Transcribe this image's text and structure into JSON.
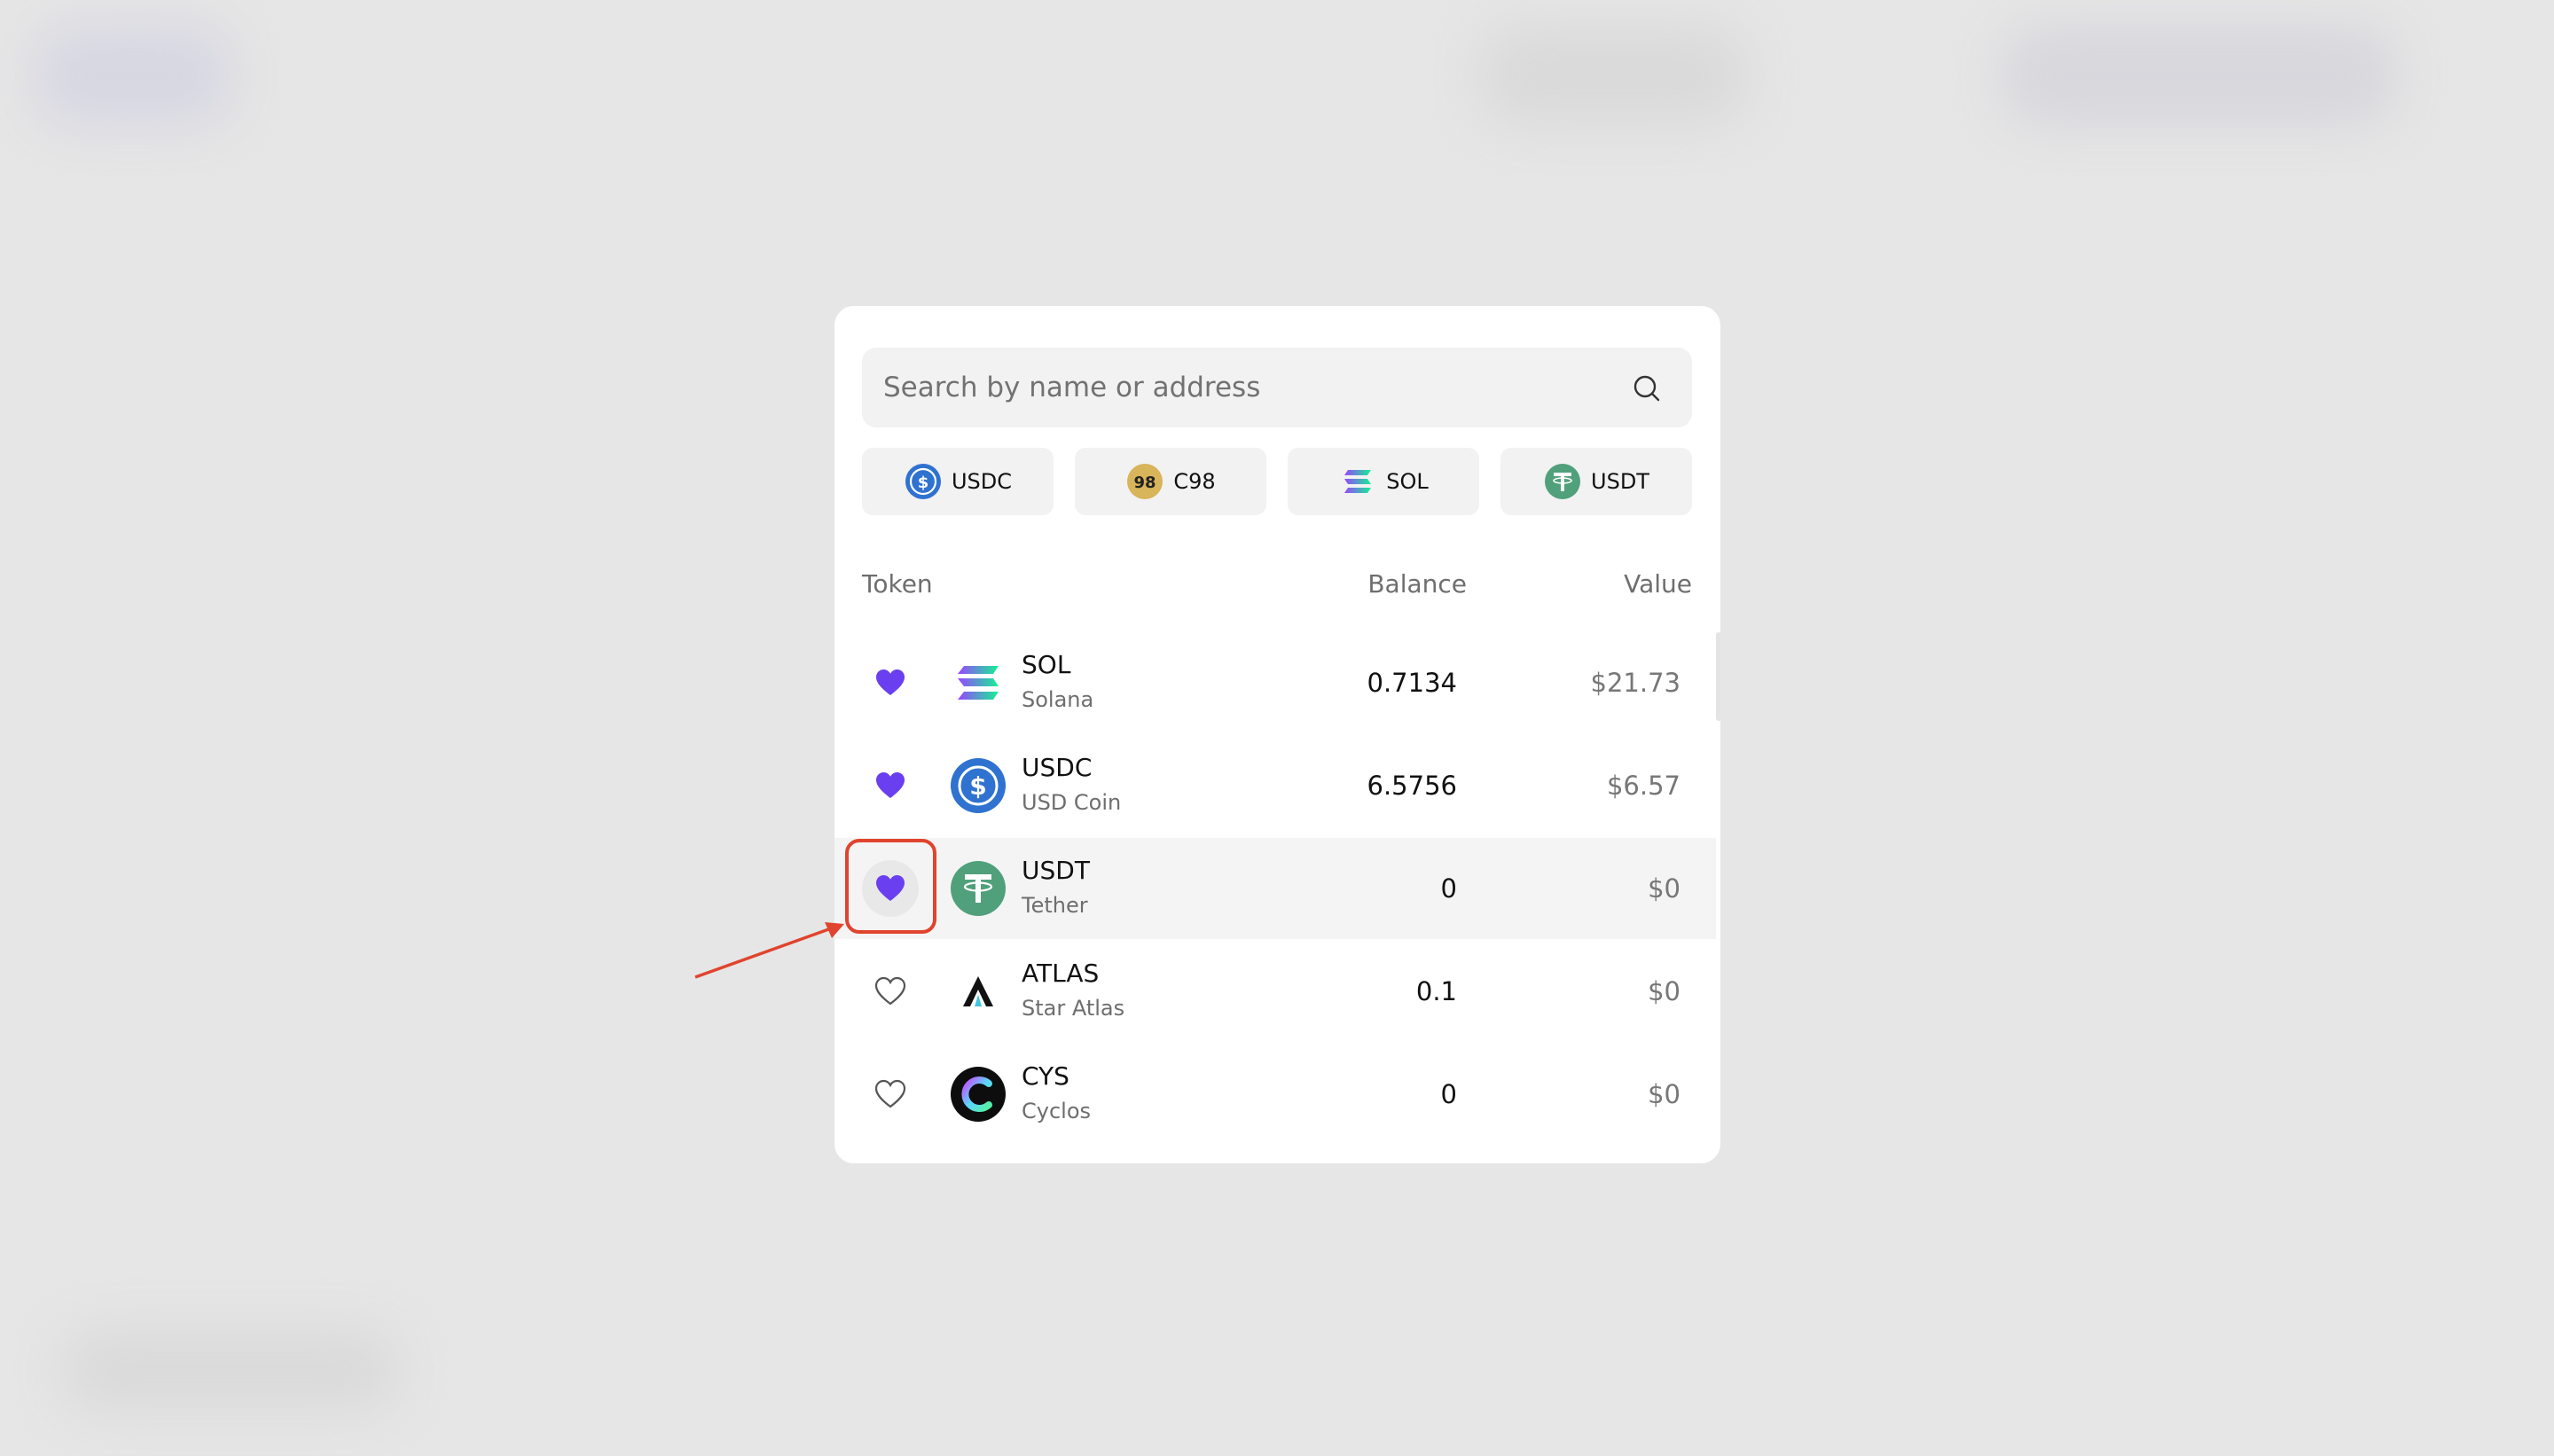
{
  "search": {
    "placeholder": "Search by name or address"
  },
  "quick_tokens": [
    {
      "symbol": "USDC",
      "icon": "usdc-icon"
    },
    {
      "symbol": "C98",
      "icon": "c98-icon"
    },
    {
      "symbol": "SOL",
      "icon": "sol-icon"
    },
    {
      "symbol": "USDT",
      "icon": "usdt-icon"
    }
  ],
  "table": {
    "headers": {
      "token": "Token",
      "balance": "Balance",
      "value": "Value"
    },
    "rows": [
      {
        "symbol": "SOL",
        "name": "Solana",
        "balance": "0.7134",
        "value": "$21.73",
        "favorite": true,
        "icon": "sol-icon"
      },
      {
        "symbol": "USDC",
        "name": "USD Coin",
        "balance": "6.5756",
        "value": "$6.57",
        "favorite": true,
        "icon": "usdc-icon"
      },
      {
        "symbol": "USDT",
        "name": "Tether",
        "balance": "0",
        "value": "$0",
        "favorite": true,
        "icon": "usdt-icon"
      },
      {
        "symbol": "ATLAS",
        "name": "Star Atlas",
        "balance": "0.1",
        "value": "$0",
        "favorite": false,
        "icon": "atlas-icon"
      },
      {
        "symbol": "CYS",
        "name": "Cyclos",
        "balance": "0",
        "value": "$0",
        "favorite": false,
        "icon": "cyclos-icon"
      }
    ]
  },
  "colors": {
    "favorite": "#6a3ff0",
    "annotation": "#e0442e",
    "usdc": "#2f72d0",
    "usdt": "#50a07b",
    "c98": "#d8b45a"
  }
}
